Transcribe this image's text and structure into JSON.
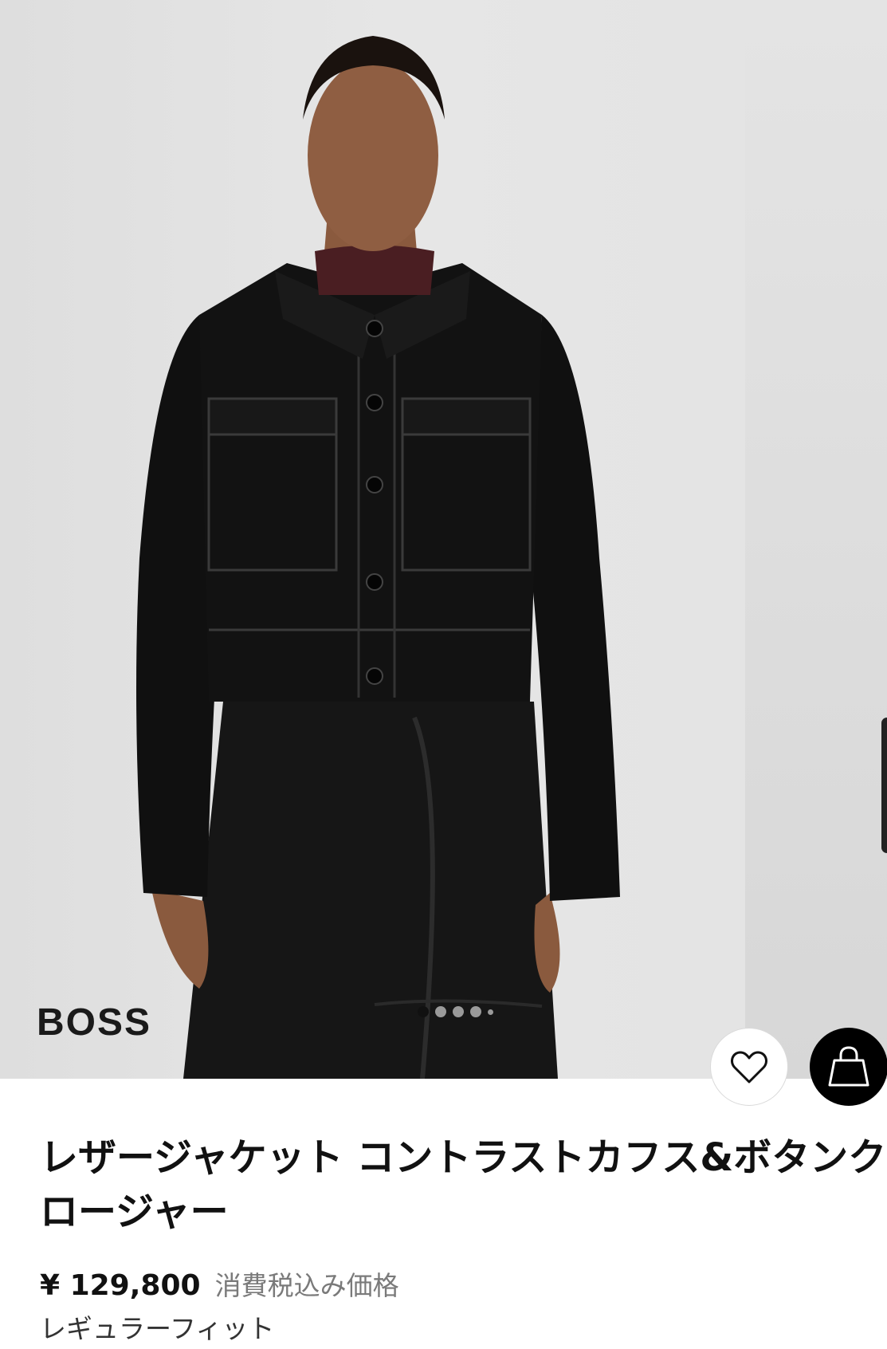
{
  "product": {
    "brand": "BOSS",
    "image_alt": "Model wearing black leather jacket",
    "title_line1": "レザージャケット コントラストカフス&ボタンク",
    "title_line2": "ロージャー",
    "price": "¥ 129,800",
    "price_note": "消費税込み価格",
    "fit": "レギュラーフィット"
  },
  "carousel": {
    "total_dots": 5,
    "active_index": 0
  },
  "icons": {
    "wishlist": "heart-outline-icon",
    "cart": "shopping-bag-icon"
  },
  "colors": {
    "background": "#ffffff",
    "photo_bg": "#e0e0e0",
    "cart_button": "#000000",
    "price_note": "#7a7a7a"
  }
}
